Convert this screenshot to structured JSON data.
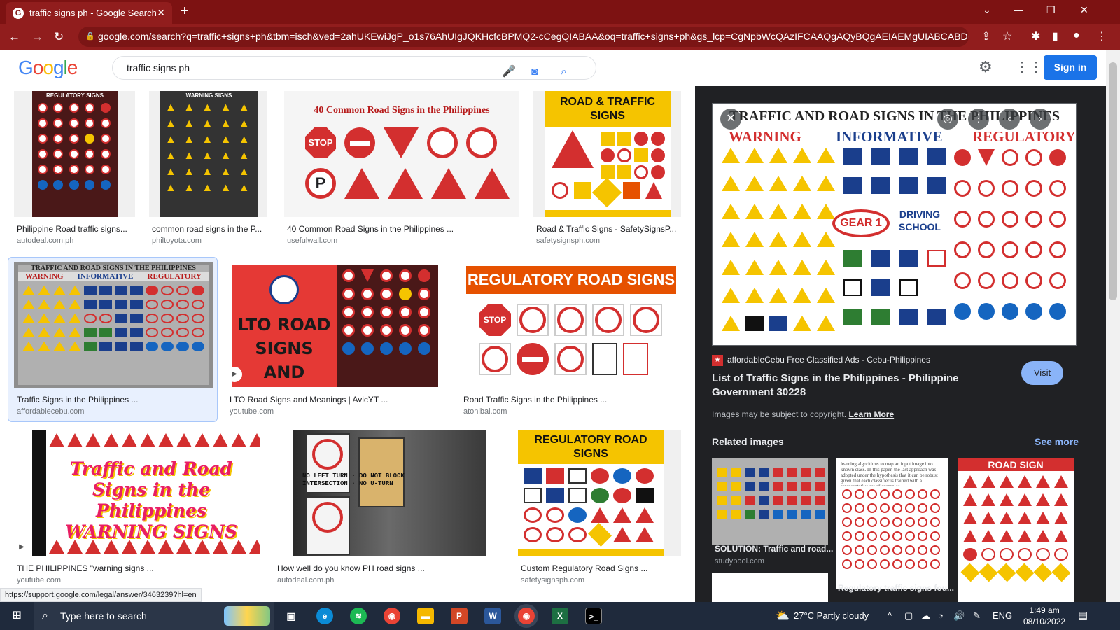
{
  "browser": {
    "tab_title": "traffic signs ph - Google Search",
    "url": "google.com/search?q=traffic+signs+ph&tbm=isch&ved=2ahUKEwiJgP_o1s76AhUIgJQKHcfcBPMQ2-cCegQIABAA&oq=traffic+signs+ph&gs_lcp=CgNpbWcQAzIFCAAQgAQyBQgAEIAEMgUIABCABDIF..."
  },
  "google": {
    "logo": "Google",
    "query": "traffic signs ph",
    "signin_label": "Sign in"
  },
  "results": [
    {
      "title": "Philippine Road traffic signs...",
      "source": "autodeal.com.ph",
      "thumb_text": "REGULATORY SIGNS"
    },
    {
      "title": "common road signs in the P...",
      "source": "philtoyota.com",
      "thumb_text": "WARNING SIGNS"
    },
    {
      "title": "40 Common Road Signs in the Philippines ...",
      "source": "usefulwall.com",
      "thumb_text": "40 Common Road Signs in the Philippines"
    },
    {
      "title": "Road & Traffic Signs - SafetySignsP...",
      "source": "safetysignsph.com",
      "thumb_text": "ROAD & TRAFFIC SIGNS"
    },
    {
      "title": "Traffic Signs in the Philippines ...",
      "source": "affordablecebu.com",
      "thumb_text": "TRAFFIC AND ROAD SIGNS IN THE PHILIPPINES"
    },
    {
      "title": "LTO Road Signs and Meanings | AvicYT ...",
      "source": "youtube.com",
      "thumb_text": "LTO ROAD SIGNS AND MEANINGS"
    },
    {
      "title": "Road Traffic Signs in the Philippines ...",
      "source": "atonibai.com",
      "thumb_text": "REGULATORY ROAD SIGNS"
    },
    {
      "title": "THE PHILIPPINES \"warning signs ...",
      "source": "youtube.com",
      "thumb_text": "Traffic and Road Signs in the Philippines WARNING SIGNS"
    },
    {
      "title": "How well do you know PH road signs ...",
      "source": "autodeal.com.ph",
      "thumb_text": "NO LEFT TURN · DO NOT BLOCK INTERSECTION · NO U-TURN"
    },
    {
      "title": "Custom Regulatory Road Signs ...",
      "source": "safetysignsph.com",
      "thumb_text": "REGULATORY ROAD SIGNS"
    }
  ],
  "preview": {
    "image_heading": "TRAFFIC AND ROAD SIGNS IN THE PHILIPPINES",
    "categories": [
      "WARNING",
      "INFORMATIVE",
      "REGULATORY"
    ],
    "center_labels": [
      "GEAR 1",
      "DRIVING SCHOOL"
    ],
    "source": "affordableCebu Free Classified Ads - Cebu-Philippines",
    "title": "List of Traffic Signs in the Philippines - Philippine Government 30228",
    "visit_label": "Visit",
    "copyright": "Images may be subject to copyright.",
    "learn_more": "Learn More",
    "related_heading": "Related images",
    "see_more": "See more",
    "related": [
      {
        "title": "SOLUTION: Traffic and road...",
        "source": "studypool.com"
      },
      {
        "title": "Regulatory traffic signs fou...",
        "source": ""
      },
      {
        "title": "ROAD SIGN",
        "source": ""
      }
    ]
  },
  "status_url": "https://support.google.com/legal/answer/3463239?hl=en",
  "taskbar": {
    "search_placeholder": "Type here to search",
    "weather": "27°C  Partly cloudy",
    "lang": "ENG",
    "time": "1:49 am",
    "date": "08/10/2022"
  },
  "colors": {
    "chrome": "#7d1212",
    "google_blue": "#1a73e8",
    "panel": "#202124",
    "sign_red": "#d32f2f",
    "sign_yellow": "#f5c400"
  }
}
